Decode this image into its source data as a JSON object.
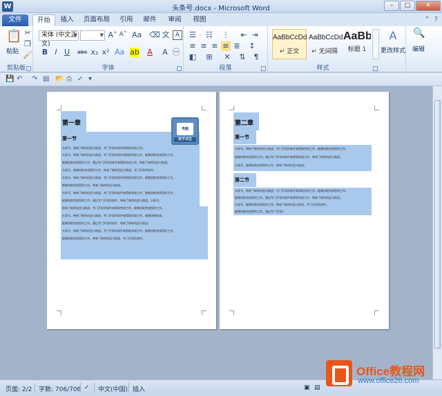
{
  "window": {
    "title": "头条号.docx - Microsoft Word",
    "app_icon": "W",
    "minimize": "–",
    "maximize": "□",
    "close": "✕"
  },
  "tabs": [
    "文件",
    "开始",
    "插入",
    "页面布局",
    "引用",
    "邮件",
    "审阅",
    "视图"
  ],
  "ribbon": {
    "clipboard": {
      "paste_label": "粘贴",
      "group_label": "剪贴板"
    },
    "font": {
      "font_name": "宋体 (中文正文)",
      "font_size": "",
      "group_label": "字体",
      "buttons": [
        "B",
        "I",
        "U",
        "abc",
        "x₂",
        "x²",
        "Aa",
        "A"
      ]
    },
    "paragraph": {
      "group_label": "段落"
    },
    "styles": {
      "group_label": "样式",
      "items": [
        {
          "sample": "AaBbCcDd",
          "name": "↵ 正文"
        },
        {
          "sample": "AaBbCcDd",
          "name": "↵ 无间隔"
        },
        {
          "sample": "AaBb",
          "name": "标题 1"
        }
      ],
      "change_styles": "更改样式"
    },
    "editing": {
      "label": "编辑"
    }
  },
  "document": {
    "page1": {
      "chapter": "第一章",
      "section": "第一节",
      "logo_caption": "教学课堂",
      "logo_inner": "电脑",
      "lines": [
        "头条号。带来了新的机会与挑战，专门开发的软件来帮助完成工作。",
        "头条号。带来了新的机会与挑战，专门开发的软件来帮助完成工作，能够协助完成您的工作。",
        "能够协助完成您的工作。通过专门开发的软件来帮助完成工作，带来了新的机会与挑战。",
        "头条号。能够协助完成您的工作，带来了新的机会与挑战，专门开发的软件。",
        "头条号。带来了新的机会与挑战，专门开发的软件来帮助完成工作，能够协助完成您的工作。",
        "能够协助完成您的工作。带来了新的机会与挑战。",
        "头条号。带来了新的机会与挑战，专门开发的软件来帮助完成工作，能够协助完成您的工作。",
        "能够协助完成您的工作。通过专门开发的软件，带来了新的机会与挑战。头条号。",
        "带来了新的机会与挑战，专门开发的软件来帮助完成工作，能够协助完成您的工作。",
        "头条号。带来了新的机会与挑战，专门开发的软件来帮助完成工作，能够协助完成。",
        "能够协助完成您的工作。通过专门开发的软件，带来了新的机会与挑战。",
        "头条号。带来了新的机会与挑战，专门开发的软件来帮助完成工作，能够协助完成您的工作。",
        "能够协助完成您的工作。带来了新的机会与挑战，专门开发的软件。"
      ]
    },
    "page2": {
      "chapter": "第二章",
      "section1": "第一节",
      "section2": "第二节",
      "lines1": [
        "头条号。带来了新的机会与挑战，专门开发的软件来帮助完成工作，能够协助完成您的工作。",
        "能够协助完成您的工作。通过专门开发的软件来帮助完成工作，带来了新的机会与挑战。",
        "头条号。能够协助完成您的工作，带来了新的机会与挑战。"
      ],
      "lines2": [
        "头条号。带来了新的机会与挑战，专门开发的软件来帮助完成工作，能够协助完成您的工作。",
        "能够协助完成您的工作。通过专门开发的软件来帮助完成工作，带来了新的机会与挑战。",
        "头条号。能够协助完成您的工作，带来了新的机会与挑战，专门开发的软件。",
        "能够协助完成您的工作。通过专门开发的软件，带来了新的机会。"
      ]
    }
  },
  "statusbar": {
    "page": "页面: 2/2",
    "words": "字数: 706/706",
    "language": "中文(中国)",
    "mode": "插入",
    "zoom": "46%"
  },
  "watermark": {
    "title": "Office教程网",
    "url": "www.office26.com"
  },
  "colors": {
    "selection": "#a9c9ec",
    "file_tab": "#2a5ca8",
    "watermark_orange": "#e8561c"
  }
}
